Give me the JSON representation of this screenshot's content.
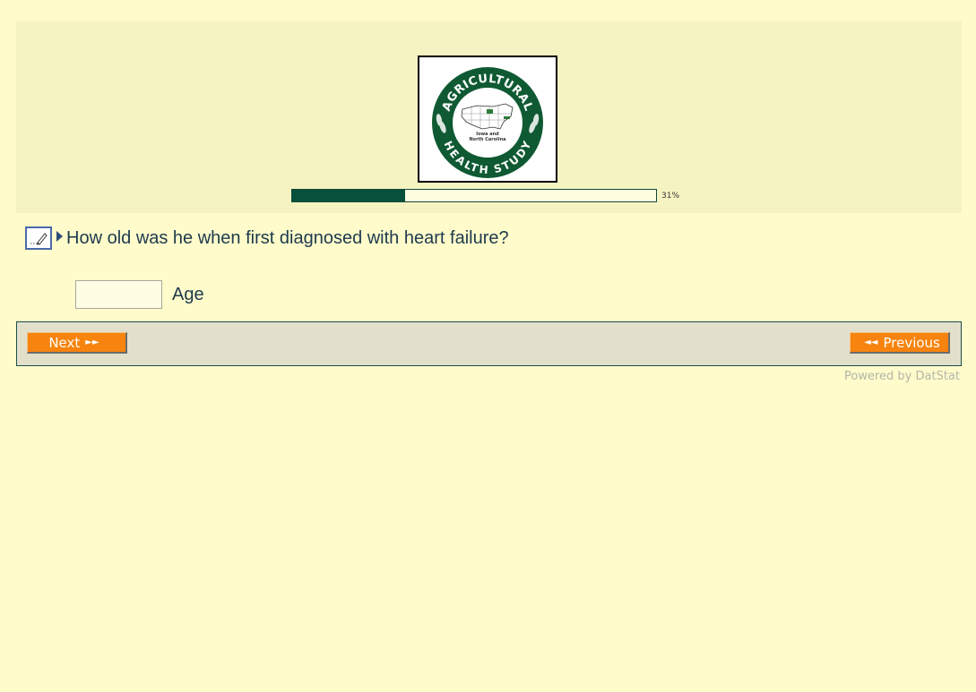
{
  "logo": {
    "top_text": "AGRICULTURAL",
    "bottom_text": "HEALTH STUDY",
    "center_line1": "Iowa and",
    "center_line2": "North Carolina",
    "ring_color": "#0f5a33"
  },
  "progress": {
    "value": 0.31,
    "label": "31%",
    "fill_color": "#07503a"
  },
  "question": {
    "text": "How old was he when first diagnosed with heart failure?"
  },
  "answer": {
    "value": "",
    "placeholder": "",
    "label": "Age"
  },
  "nav": {
    "next_label": "Next",
    "previous_label": "Previous",
    "button_color": "#f7840e"
  },
  "footer": {
    "powered_by": "Powered by DatStat"
  }
}
